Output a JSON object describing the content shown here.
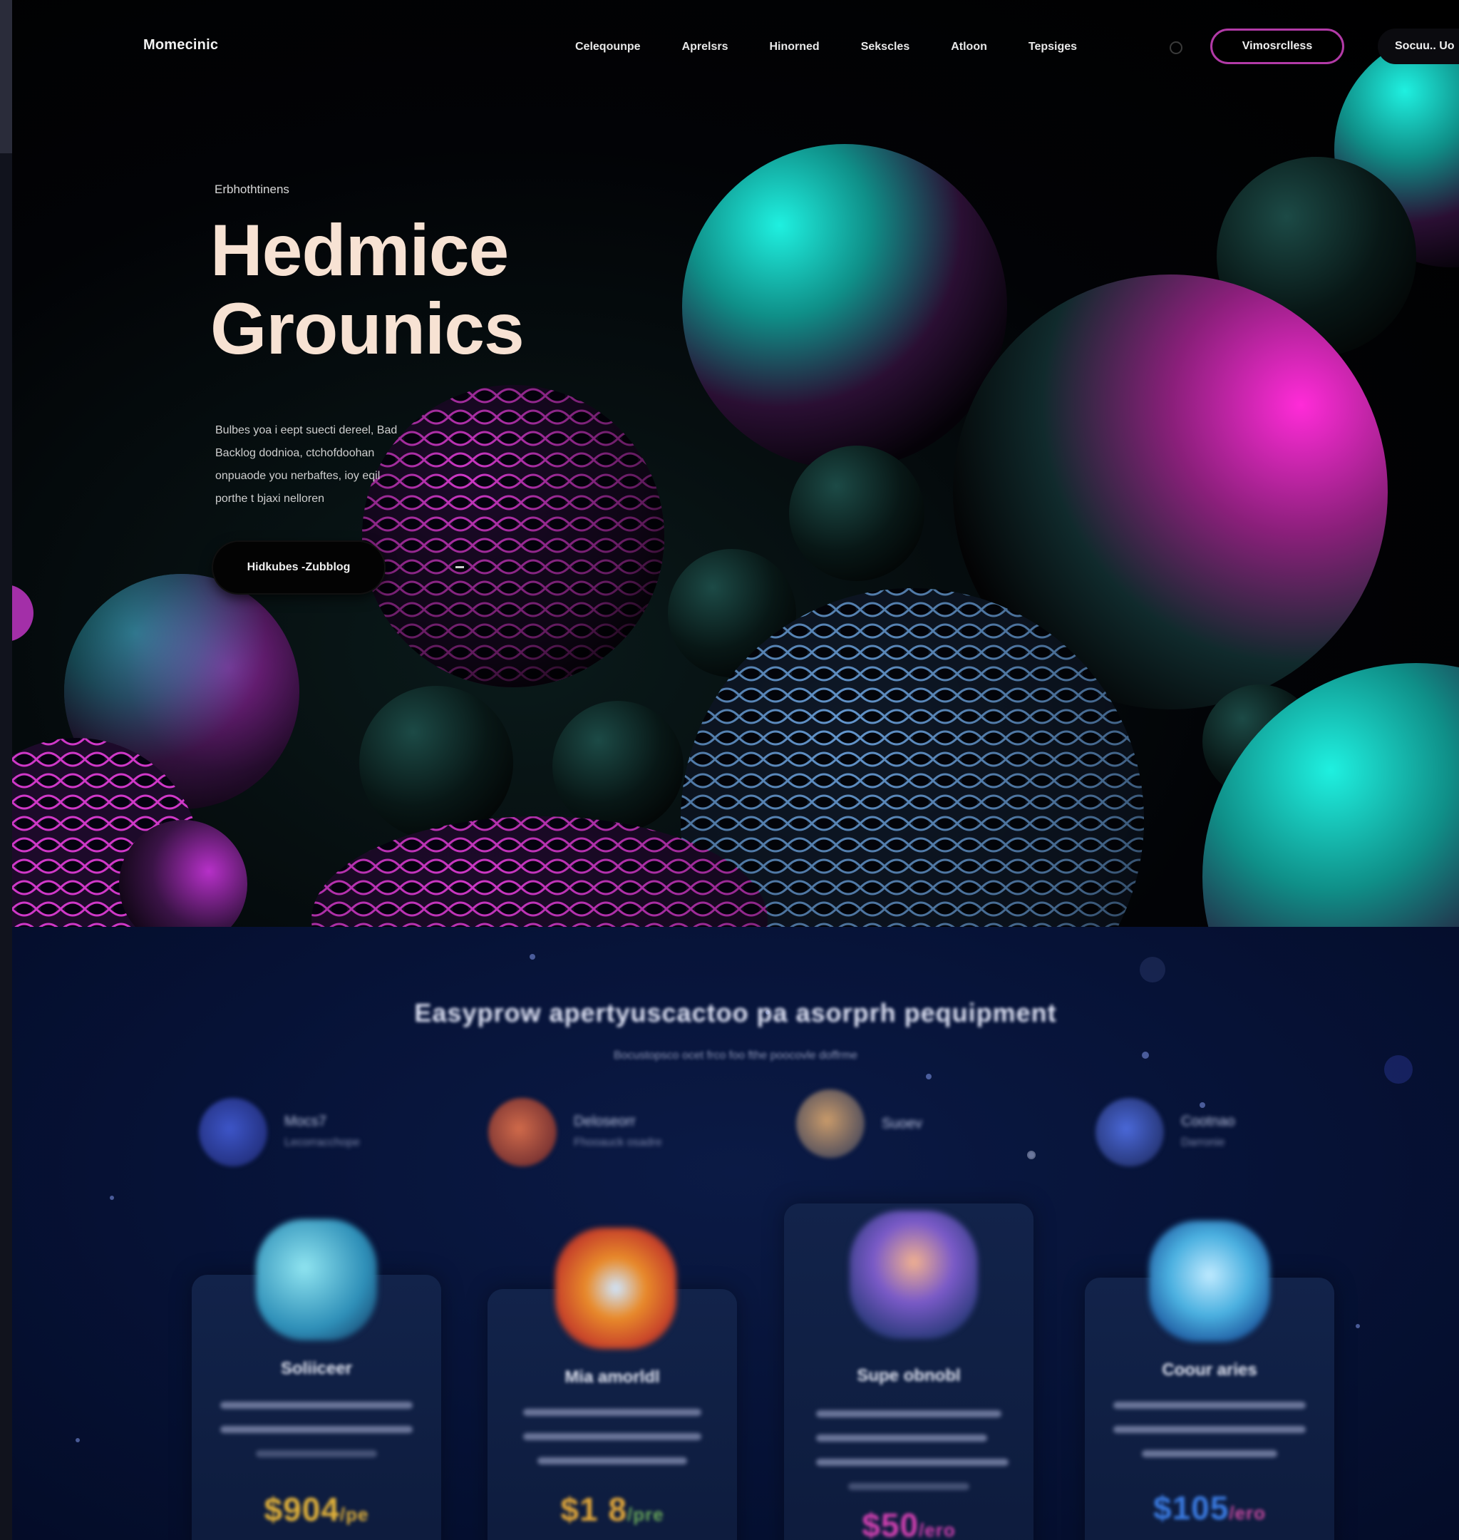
{
  "nav": {
    "brand": "Momecinic",
    "links": [
      "Celeqounpe",
      "Aprelsrs",
      "Hinorned",
      "Sekscles",
      "Atloon",
      "Tepsiges"
    ],
    "cta": "Vimosrclless",
    "secondary": "Socuu.. Uo"
  },
  "hero": {
    "eyebrow": "Erbhothtinens",
    "title_line1": "Hedmice",
    "title_line2": "Grounics",
    "description": [
      "Bulbes yoa i eept suecti dereel, Bad",
      "Backlog dodnioa, ctchofdoohan",
      "onpuaode you nerbaftes, ioy eqil",
      "porthe t bjaxi nelloren"
    ],
    "button": "Hidkubes -Zubblog"
  },
  "pricing": {
    "title": "Easyprow apertyuscactoo pa asorprh pequipment",
    "subtitle": "Bocustopsco ocet frco foo fthe poocovle doffrme",
    "personas": [
      {
        "name": "Mocs7",
        "role": "Lecorracchope",
        "color": "#2a3fa0"
      },
      {
        "name": "Deloseorr",
        "role": "Fhooauck osadre",
        "color": "#b24a3a"
      },
      {
        "name": "Suoev",
        "role": "",
        "color": "#3a4e7a"
      },
      {
        "name": "Cootnao",
        "role": "Darronie",
        "color": "#2b4aa0"
      }
    ],
    "cards": [
      {
        "title": "Soliiceer",
        "price": "$904",
        "unit": "/pe",
        "price_color": "#e2b23a",
        "art_color": "#3fa8c8"
      },
      {
        "title": "Mia amorldl",
        "price": "$1 8",
        "unit": "/pre",
        "price_color": "#e0a63a",
        "art_color": "#e08a2a"
      },
      {
        "title": "Supe obnobl",
        "price": "$50",
        "unit": "/ero",
        "price_color": "#d040b0",
        "art_color": "#6a5aa8"
      },
      {
        "title": "Coour aries",
        "price": "$105",
        "unit": "/ero",
        "price_color": "#3a7ae0",
        "art_color": "#3aa6d8"
      }
    ]
  },
  "colors": {
    "accent_magenta": "#b23aa7",
    "title_cream": "#f7e2d3",
    "hero_bg": "#000000",
    "pricing_bg": "#061236"
  }
}
